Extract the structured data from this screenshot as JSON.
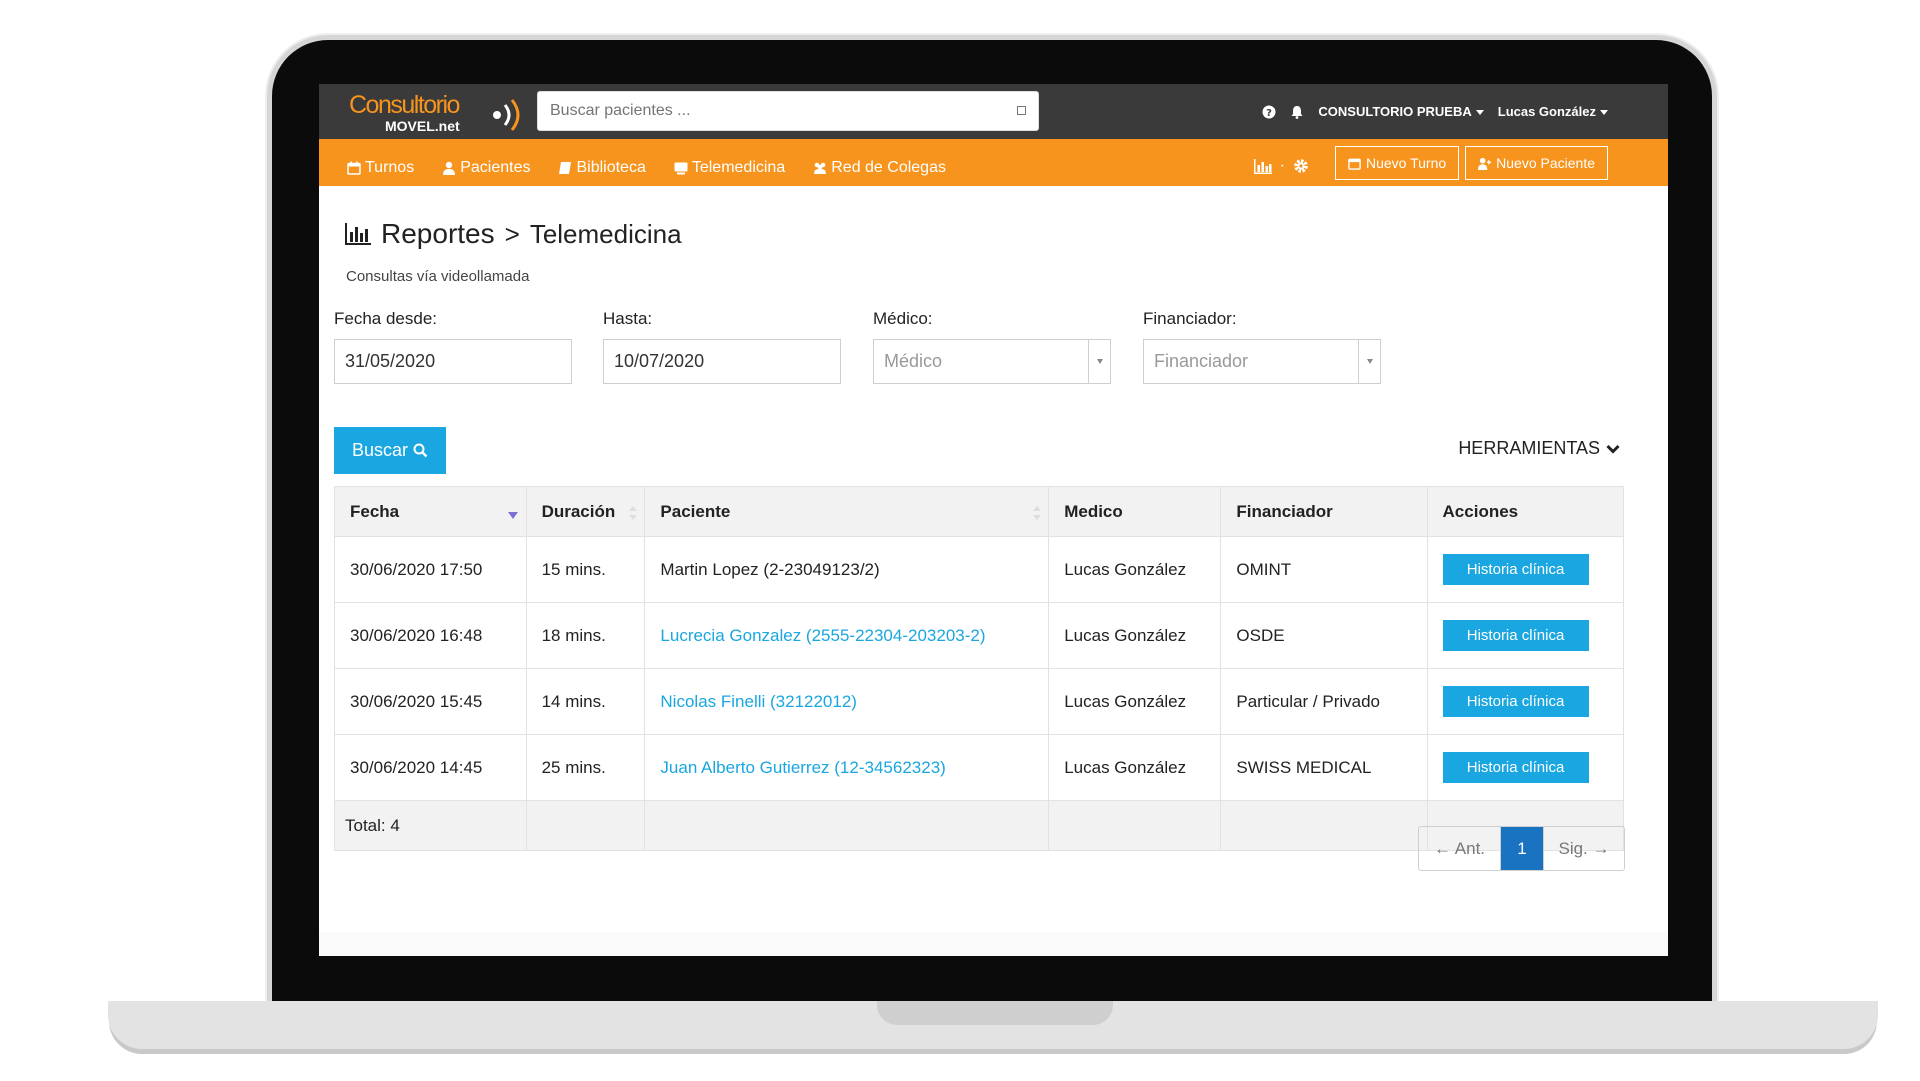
{
  "app": {
    "logo_top": "Consultorio",
    "logo_bottom": "MOVEL.net"
  },
  "search": {
    "placeholder": "Buscar pacientes ..."
  },
  "topbar": {
    "consultorio": "CONSULTORIO PRUEBA",
    "user": "Lucas González"
  },
  "nav": {
    "items": [
      {
        "label": "Turnos",
        "icon": "calendar-icon"
      },
      {
        "label": "Pacientes",
        "icon": "user-icon"
      },
      {
        "label": "Biblioteca",
        "icon": "book-icon"
      },
      {
        "label": "Telemedicina",
        "icon": "monitor-icon"
      },
      {
        "label": "Red de Colegas",
        "icon": "users-icon"
      }
    ],
    "dot": "·",
    "new_turno": "Nuevo Turno",
    "new_paciente": "Nuevo Paciente"
  },
  "page": {
    "crumb1": "Reportes",
    "separator": ">",
    "crumb2": "Telemedicina",
    "subtitle": "Consultas vía videollamada"
  },
  "filters": {
    "desde_label": "Fecha desde:",
    "desde_value": "31/05/2020",
    "hasta_label": "Hasta:",
    "hasta_value": "10/07/2020",
    "medico_label": "Médico:",
    "medico_placeholder": "Médico",
    "financiador_label": "Financiador:",
    "financiador_placeholder": "Financiador",
    "search_button": "Buscar",
    "tools": "HERRAMIENTAS"
  },
  "table": {
    "headers": [
      "Fecha",
      "Duración",
      "Paciente",
      "Medico",
      "Financiador",
      "Acciones"
    ],
    "rows": [
      {
        "fecha": "30/06/2020 17:50",
        "duracion": "15 mins.",
        "paciente": "Martin Lopez (2-23049123/2)",
        "medico": "Lucas González",
        "financiador": "OMINT",
        "accion": "Historia clínica"
      },
      {
        "fecha": "30/06/2020 16:48",
        "duracion": "18 mins.",
        "paciente": "Lucrecia Gonzalez (2555-22304-203203-2)",
        "medico": "Lucas González",
        "financiador": "OSDE",
        "accion": "Historia clínica"
      },
      {
        "fecha": "30/06/2020 15:45",
        "duracion": "14 mins.",
        "paciente": "Nicolas Finelli (32122012)",
        "medico": "Lucas González",
        "financiador": "Particular / Privado",
        "accion": "Historia clínica"
      },
      {
        "fecha": "30/06/2020 14:45",
        "duracion": "25 mins.",
        "paciente": "Juan Alberto Gutierrez (12-34562323)",
        "medico": "Lucas González",
        "financiador": "SWISS MEDICAL",
        "accion": "Historia clínica"
      }
    ],
    "total": "Total: 4"
  },
  "pagination": {
    "prev": "← Ant.",
    "current": "1",
    "next": "Sig. →"
  },
  "colors": {
    "brand_orange": "#f7941d",
    "accent_blue": "#1aa6e0",
    "topbar_dark": "#3a3a3a",
    "pager_active": "#1a73c0"
  }
}
